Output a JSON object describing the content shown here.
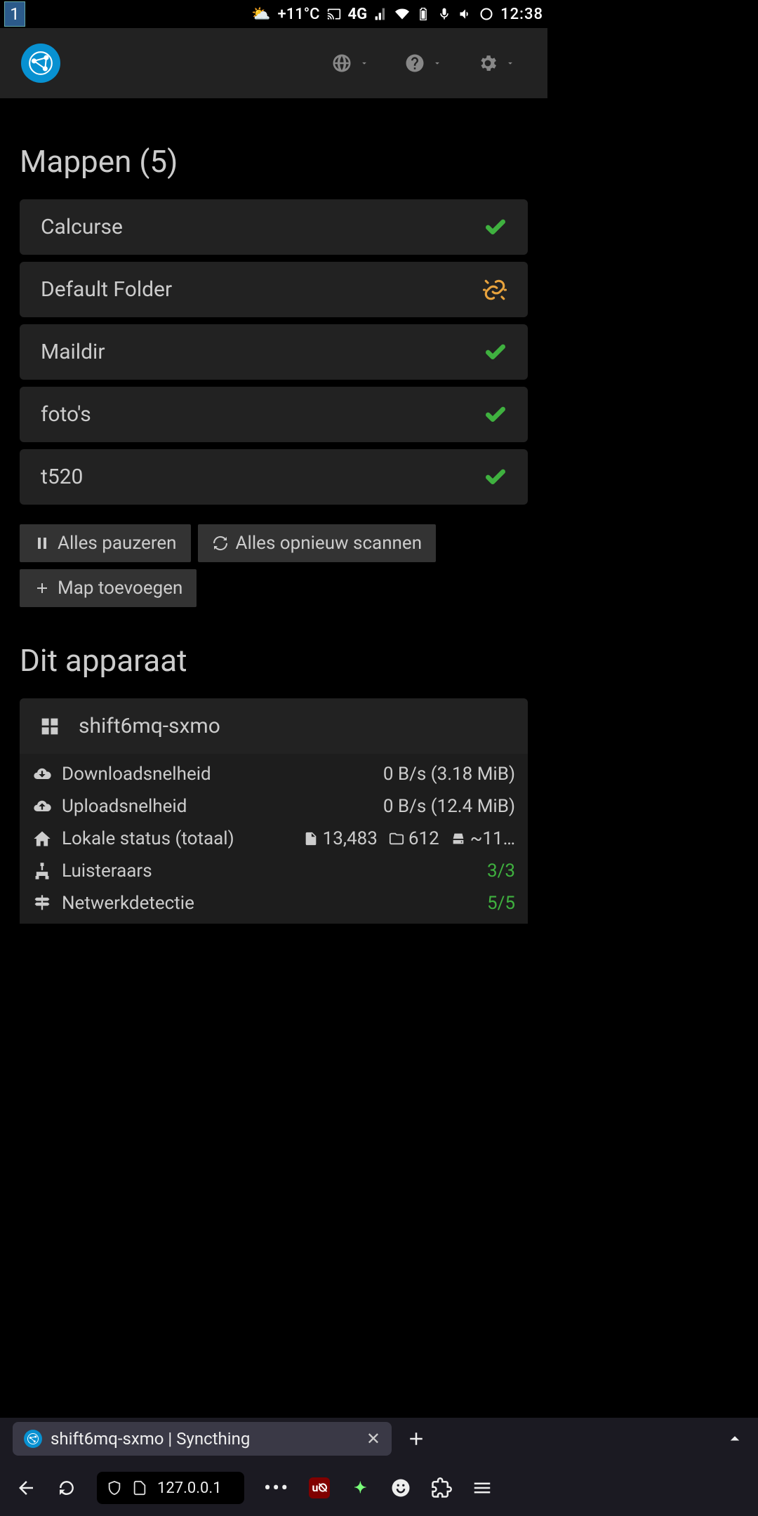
{
  "statusbar": {
    "workspace": "1",
    "temp": "+11°C",
    "net_type": "4G",
    "clock": "12:38"
  },
  "folders": {
    "heading": "Mappen (5)",
    "items": [
      {
        "name": "Calcurse",
        "status": "idle"
      },
      {
        "name": "Default Folder",
        "status": "disconnected"
      },
      {
        "name": "Maildir",
        "status": "idle"
      },
      {
        "name": "foto's",
        "status": "idle"
      },
      {
        "name": "t520",
        "status": "idle"
      }
    ]
  },
  "buttons": {
    "pause_all": "Alles pauzeren",
    "rescan_all": "Alles opnieuw scannen",
    "add_folder": "Map toevoegen"
  },
  "this_device": {
    "heading": "Dit apparaat",
    "name": "shift6mq-sxmo",
    "download_label": "Downloadsnelheid",
    "download_value": "0 B/s (3.18 MiB)",
    "upload_label": "Uploadsnelheid",
    "upload_value": "0 B/s (12.4 MiB)",
    "local_label": "Lokale status (totaal)",
    "local_files": "13,483",
    "local_dirs": "612",
    "local_size": "~11…",
    "listeners_label": "Luisteraars",
    "listeners_value": "3/3",
    "discovery_label": "Netwerkdetectie",
    "discovery_value": "5/5"
  },
  "browser": {
    "tab_title": "shift6mq-sxmo | Syncthing",
    "url": "127.0.0.1"
  }
}
